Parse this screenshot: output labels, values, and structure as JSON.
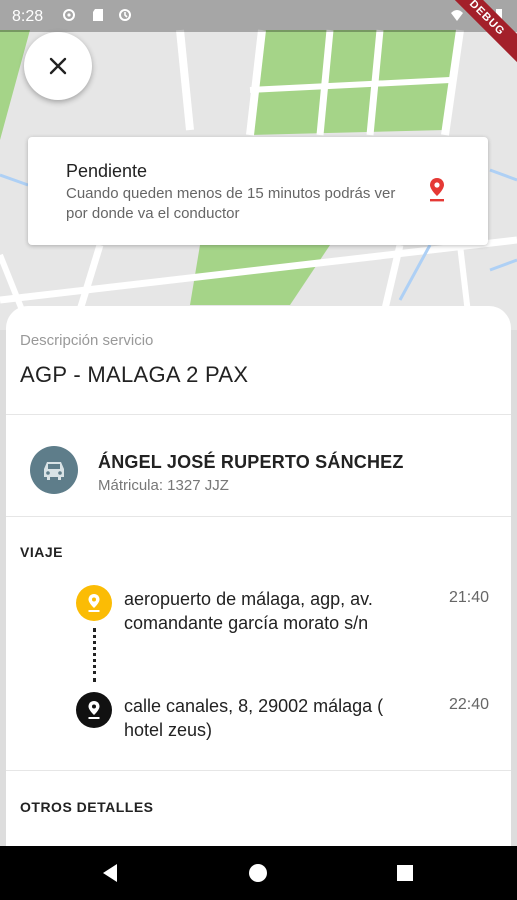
{
  "status_bar": {
    "time": "8:28",
    "debug_label": "DEBUG"
  },
  "map": {
    "road_color": "#ffffff",
    "park_color": "#a5d488",
    "base_color": "#e6e6e6",
    "water_line_color": "#aed0f5"
  },
  "close_button": {
    "icon": "close-icon"
  },
  "pending_card": {
    "title": "Pendiente",
    "subtitle": "Cuando queden menos de 15 minutos podrás ver por donde va el conductor",
    "icon": "location-pin-icon",
    "icon_color": "#e53935"
  },
  "service": {
    "label": "Descripción servicio",
    "value": "AGP - MALAGA 2 PAX"
  },
  "driver": {
    "name": "ÁNGEL JOSÉ RUPERTO SÁNCHEZ",
    "plate": "Mátricula: 1327 JJZ",
    "icon": "car-icon",
    "avatar_color": "#5e7d8a"
  },
  "trip": {
    "title": "VIAJE",
    "stops": [
      {
        "address": "aeropuerto de málaga, agp, av. comandante garcía morato s/n",
        "time": "21:40",
        "icon_color": "#fbbc05"
      },
      {
        "address": "calle canales, 8, 29002 málaga ( hotel zeus)",
        "time": "22:40",
        "icon_color": "#111111"
      }
    ]
  },
  "other_details": {
    "title": "OTROS DETALLES"
  },
  "nav_bar": {
    "back": "back-icon",
    "home": "home-icon",
    "recents": "recents-icon"
  }
}
